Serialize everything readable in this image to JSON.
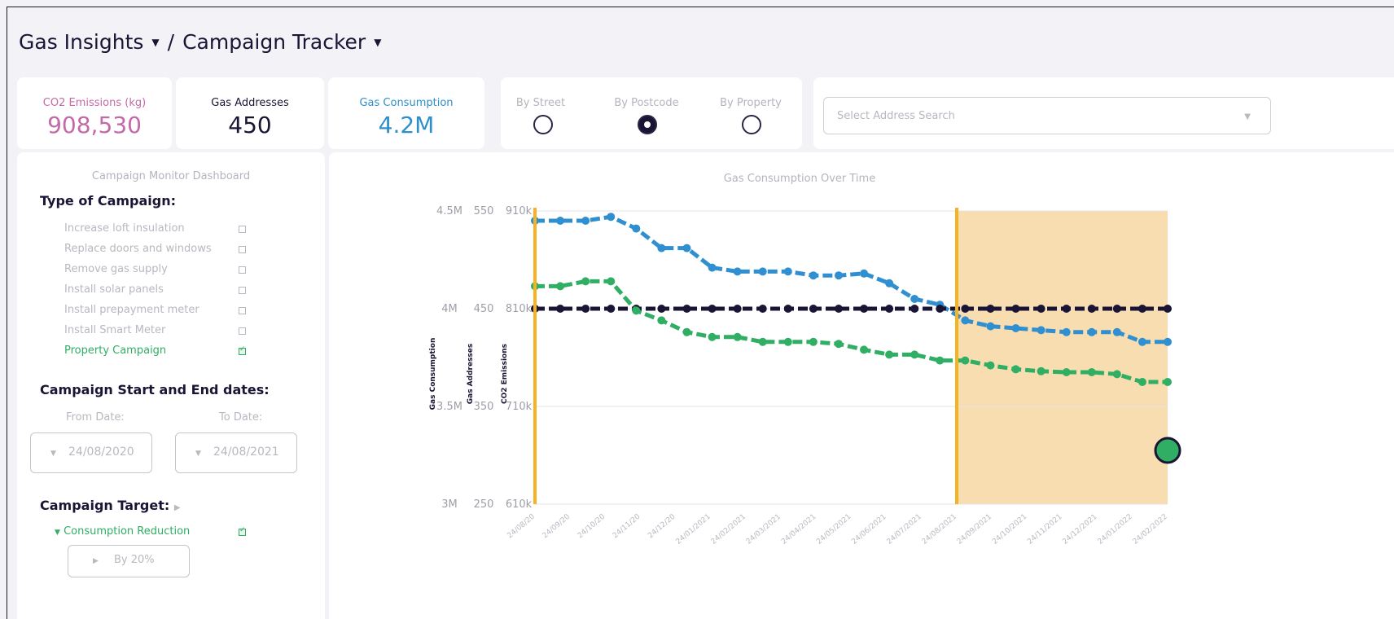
{
  "header": {
    "app": "Gas Insights",
    "page": "Campaign Tracker",
    "separator": "/"
  },
  "stats": {
    "co2": {
      "label": "CO2 Emissions (kg)",
      "value": "908,530",
      "color": "#c46aa6"
    },
    "addresses": {
      "label": "Gas Addresses",
      "value": "450",
      "color": "#1b1535"
    },
    "consumption": {
      "label": "Gas Consumption",
      "value": "4.2M",
      "color": "#2f8fc9"
    }
  },
  "view_options": [
    {
      "label": "By Street",
      "selected": false
    },
    {
      "label": "By Postcode",
      "selected": true
    },
    {
      "label": "By Property",
      "selected": false
    }
  ],
  "address_search": {
    "placeholder": "Select Address Search"
  },
  "sidebar": {
    "title": "Campaign Monitor Dashboard",
    "type_heading": "Type of Campaign:",
    "campaigns": [
      {
        "label": "Increase loft insulation",
        "checked": false
      },
      {
        "label": "Replace doors and windows",
        "checked": false
      },
      {
        "label": "Remove gas supply",
        "checked": false
      },
      {
        "label": "Install solar panels",
        "checked": false
      },
      {
        "label": "Install prepayment meter",
        "checked": false
      },
      {
        "label": "Install Smart Meter",
        "checked": false
      },
      {
        "label": "Property Campaign",
        "checked": true
      }
    ],
    "dates_heading": "Campaign Start and End dates:",
    "from_label": "From Date:",
    "to_label": "To Date:",
    "from_value": "24/08/2020",
    "to_value": "24/08/2021",
    "target_heading": "Campaign Target:",
    "target_option": "Consumption Reduction",
    "target_value": "By 20%"
  },
  "chart_data": {
    "type": "line",
    "title": "Gas Consumption Over Time",
    "axes": [
      {
        "label": "Gas Consumption",
        "ticks": [
          "4.5M",
          "4M",
          "3.5M",
          "3M"
        ],
        "range": [
          3000000,
          4500000
        ]
      },
      {
        "label": "Gas Addresses",
        "ticks": [
          "550",
          "450",
          "350",
          "250"
        ],
        "range": [
          250,
          550
        ]
      },
      {
        "label": "CO2 Emissions",
        "ticks": [
          "910k",
          "810k",
          "710k",
          "610k"
        ],
        "range": [
          610000,
          910000
        ]
      }
    ],
    "x_tick_labels": [
      "24/08/20",
      "24/09/20",
      "24/10/20",
      "24/11/20",
      "24/12/20",
      "24/01/2021",
      "24/02/2021",
      "24/03/2021",
      "24/04/2021",
      "24/05/2021",
      "24/06/2021",
      "24/07/2021",
      "24/08/2021",
      "24/09/2021",
      "24/10/2021",
      "24/11/2021",
      "24/12/2021",
      "24/01/2022",
      "24/02/2022"
    ],
    "campaign_start": "24/08/20",
    "campaign_end": "24/08/2021",
    "forecast_region": [
      "24/08/2021",
      "24/02/2022"
    ],
    "series": [
      {
        "axis": "Gas Consumption",
        "color": "#2f8fd0",
        "values": [
          4.45,
          4.45,
          4.45,
          4.47,
          4.41,
          4.31,
          4.31,
          4.21,
          4.19,
          4.19,
          4.19,
          4.17,
          4.17,
          4.18,
          4.13,
          4.05,
          4.02,
          3.94,
          3.91,
          3.9,
          3.89,
          3.88,
          3.88,
          3.88,
          3.83,
          3.83
        ]
      },
      {
        "axis": "Gas Addresses",
        "color": "#1b1535",
        "values": [
          450,
          450,
          450,
          450,
          450,
          450,
          450,
          450,
          450,
          450,
          450,
          450,
          450,
          450,
          450,
          450,
          450,
          450,
          450,
          450,
          450,
          450,
          450,
          450,
          450,
          450
        ]
      },
      {
        "axis": "CO2 Emissions",
        "color": "#2fae64",
        "values": [
          833,
          833,
          838,
          838,
          808,
          798,
          786,
          781,
          781,
          776,
          776,
          776,
          774,
          768,
          763,
          763,
          757,
          757,
          752,
          748,
          746,
          745,
          745,
          743,
          735,
          735
        ]
      }
    ],
    "colors": {
      "marker": "#f5b324",
      "forecast_fill": "#f8ddb0",
      "grid": "#e4e3e8"
    }
  }
}
